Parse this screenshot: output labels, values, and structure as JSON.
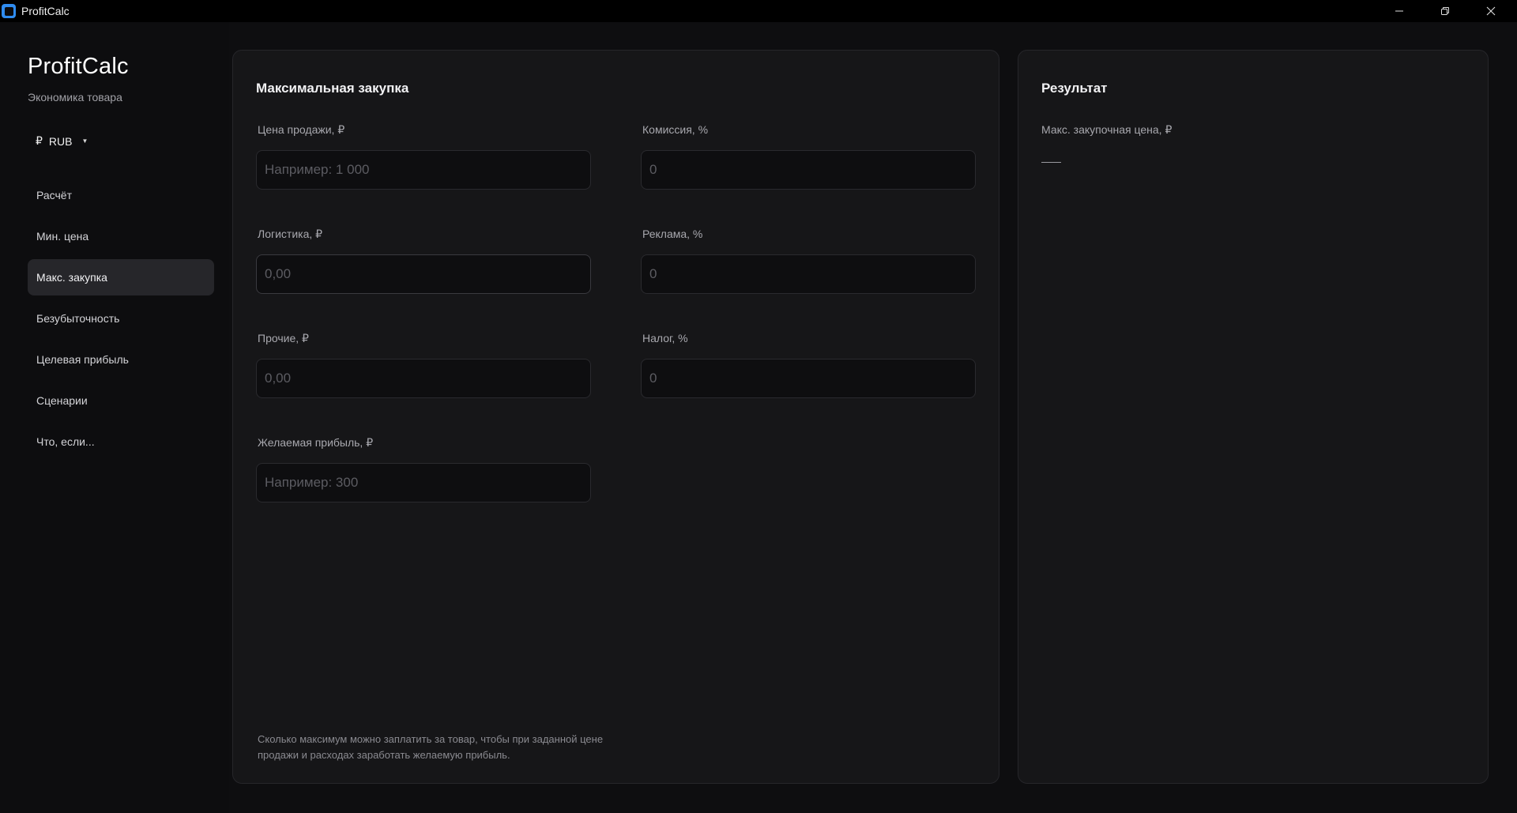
{
  "window": {
    "title": "ProfitCalc"
  },
  "sidebar": {
    "brand": "ProfitCalc",
    "subtitle": "Экономика товара",
    "currency": {
      "symbol": "₽",
      "code": "RUB"
    },
    "items": [
      {
        "label": "Расчёт",
        "active": false
      },
      {
        "label": "Мин. цена",
        "active": false
      },
      {
        "label": "Макс. закупка",
        "active": true
      },
      {
        "label": "Безубыточность",
        "active": false
      },
      {
        "label": "Целевая прибыль",
        "active": false
      },
      {
        "label": "Сценарии",
        "active": false
      },
      {
        "label": "Что, если...",
        "active": false
      }
    ]
  },
  "main": {
    "title": "Максимальная закупка",
    "fields": {
      "sale_price": {
        "label": "Цена продажи, ₽",
        "placeholder": "Например: 1 000",
        "value": ""
      },
      "commission": {
        "label": "Комиссия, %",
        "placeholder": "0",
        "value": ""
      },
      "logistics": {
        "label": "Логистика, ₽",
        "placeholder": "0,00",
        "value": ""
      },
      "advertising": {
        "label": "Реклама, %",
        "placeholder": "0",
        "value": ""
      },
      "other": {
        "label": "Прочие, ₽",
        "placeholder": "0,00",
        "value": ""
      },
      "tax": {
        "label": "Налог, %",
        "placeholder": "0",
        "value": ""
      },
      "desired_profit": {
        "label": "Желаемая прибыль, ₽",
        "placeholder": "Например: 300",
        "value": ""
      }
    },
    "hint_line1": "Сколько максимум можно заплатить за товар, чтобы при заданной цене",
    "hint_line2": "продажи и расходах заработать желаемую прибыль."
  },
  "result": {
    "title": "Результат",
    "label": "Макс. закупочная цена, ₽"
  },
  "colors": {
    "accent": "#2f8cf0",
    "background": "#0e0e10",
    "panel": "#161618",
    "active_nav": "#26262a"
  },
  "icons": {
    "app": "app-icon",
    "minimize": "minimize-icon",
    "restore": "restore-icon",
    "close": "close-icon",
    "currency_caret": "caret-down-icon"
  }
}
